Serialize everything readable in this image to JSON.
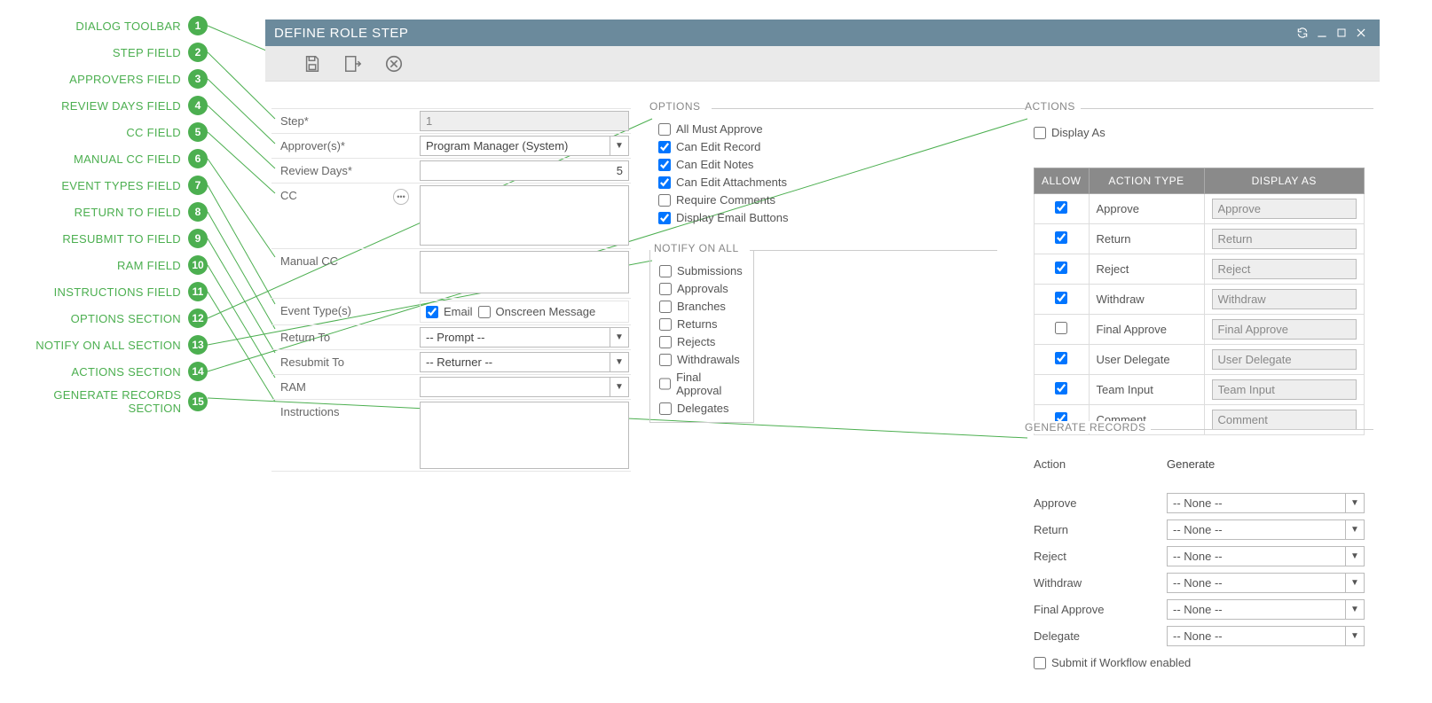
{
  "annotations": [
    {
      "num": "1",
      "text": "DIALOG TOOLBAR"
    },
    {
      "num": "2",
      "text": "STEP FIELD"
    },
    {
      "num": "3",
      "text": "APPROVERS FIELD"
    },
    {
      "num": "4",
      "text": "REVIEW DAYS FIELD"
    },
    {
      "num": "5",
      "text": "CC FIELD"
    },
    {
      "num": "6",
      "text": "MANUAL CC FIELD"
    },
    {
      "num": "7",
      "text": "EVENT TYPES FIELD"
    },
    {
      "num": "8",
      "text": "RETURN TO FIELD"
    },
    {
      "num": "9",
      "text": "RESUBMIT TO FIELD"
    },
    {
      "num": "10",
      "text": "RAM FIELD"
    },
    {
      "num": "11",
      "text": "INSTRUCTIONS FIELD"
    },
    {
      "num": "12",
      "text": "OPTIONS SECTION"
    },
    {
      "num": "13",
      "text": "NOTIFY ON ALL SECTION"
    },
    {
      "num": "14",
      "text": "ACTIONS SECTION"
    },
    {
      "num": "15",
      "text": "GENERATE RECORDS SECTION"
    }
  ],
  "titlebar": {
    "title": "DEFINE ROLE STEP"
  },
  "form": {
    "step": {
      "label": "Step*",
      "value": "1"
    },
    "approvers": {
      "label": "Approver(s)*",
      "value": "Program Manager (System)"
    },
    "review_days": {
      "label": "Review Days*",
      "value": "5"
    },
    "cc": {
      "label": "CC",
      "value": ""
    },
    "manual_cc": {
      "label": "Manual CC",
      "value": ""
    },
    "event_types": {
      "label": "Event Type(s)",
      "email": "Email",
      "onscreen": "Onscreen Message"
    },
    "return_to": {
      "label": "Return To",
      "value": "-- Prompt --"
    },
    "resubmit_to": {
      "label": "Resubmit To",
      "value": "-- Returner --"
    },
    "ram": {
      "label": "RAM",
      "value": ""
    },
    "instructions": {
      "label": "Instructions",
      "value": ""
    }
  },
  "options": {
    "legend": "OPTIONS",
    "items": [
      {
        "label": "All Must Approve",
        "checked": false
      },
      {
        "label": "Can Edit Record",
        "checked": true
      },
      {
        "label": "Can Edit Notes",
        "checked": true
      },
      {
        "label": "Can Edit Attachments",
        "checked": true
      },
      {
        "label": "Require Comments",
        "checked": false
      },
      {
        "label": "Display Email Buttons",
        "checked": true
      }
    ]
  },
  "notify": {
    "legend": "NOTIFY ON ALL",
    "items": [
      {
        "label": "Submissions",
        "checked": false
      },
      {
        "label": "Approvals",
        "checked": false
      },
      {
        "label": "Branches",
        "checked": false
      },
      {
        "label": "Returns",
        "checked": false
      },
      {
        "label": "Rejects",
        "checked": false
      },
      {
        "label": "Withdrawals",
        "checked": false
      },
      {
        "label": "Final Approval",
        "checked": false
      },
      {
        "label": "Delegates",
        "checked": false
      }
    ]
  },
  "actions": {
    "legend": "ACTIONS",
    "display_as_label": "Display As",
    "headers": {
      "allow": "ALLOW",
      "type": "ACTION TYPE",
      "display": "DISPLAY AS"
    },
    "rows": [
      {
        "allow": true,
        "type": "Approve",
        "display": "Approve"
      },
      {
        "allow": true,
        "type": "Return",
        "display": "Return"
      },
      {
        "allow": true,
        "type": "Reject",
        "display": "Reject"
      },
      {
        "allow": true,
        "type": "Withdraw",
        "display": "Withdraw"
      },
      {
        "allow": false,
        "type": "Final Approve",
        "display": "Final Approve"
      },
      {
        "allow": true,
        "type": "User Delegate",
        "display": "User Delegate"
      },
      {
        "allow": true,
        "type": "Team Input",
        "display": "Team Input"
      },
      {
        "allow": true,
        "type": "Comment",
        "display": "Comment"
      }
    ]
  },
  "generate": {
    "legend": "GENERATE RECORDS",
    "action_label": "Action",
    "action_value": "Generate",
    "rows": [
      {
        "label": "Approve",
        "value": "-- None --"
      },
      {
        "label": "Return",
        "value": "-- None --"
      },
      {
        "label": "Reject",
        "value": "-- None --"
      },
      {
        "label": "Withdraw",
        "value": "-- None --"
      },
      {
        "label": "Final Approve",
        "value": "-- None --"
      },
      {
        "label": "Delegate",
        "value": "-- None --"
      }
    ],
    "submit_label": "Submit if Workflow enabled"
  }
}
